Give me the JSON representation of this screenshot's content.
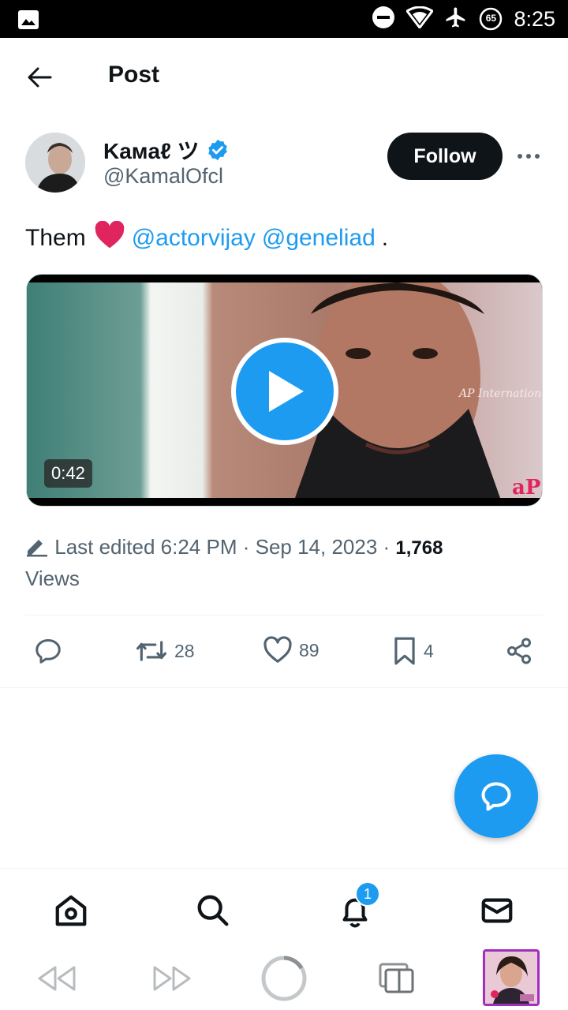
{
  "status_bar": {
    "time": "8:25",
    "battery_level": "65",
    "icons": [
      "image-icon",
      "do-not-disturb-icon",
      "wifi-icon",
      "airplane-icon",
      "battery-icon"
    ]
  },
  "header": {
    "title": "Post",
    "back_icon": "arrow-left-icon"
  },
  "author": {
    "name": "Kaмaℓ ツ",
    "handle": "@KamalOfcl",
    "verified": true,
    "follow_label": "Follow",
    "more_icon": "more-horizontal-icon"
  },
  "tweet": {
    "text_prefix": "Them",
    "emoji": "heart-emoji",
    "mention_1": "@actorvijay",
    "mention_2": "@geneliad",
    "text_suffix": "."
  },
  "video": {
    "duration": "0:42",
    "play_icon": "play-icon"
  },
  "meta": {
    "edited_icon": "pencil-icon",
    "edited_text": "Last edited 6:24 PM · Sep 14, 2023 ·",
    "views_count": "1,768",
    "views_label": "Views"
  },
  "actions": {
    "reply_count": "",
    "retweet_count": "28",
    "like_count": "89",
    "bookmark_count": "4"
  },
  "bottom_nav": {
    "notifications_badge": "1",
    "items": [
      "home-icon",
      "search-icon",
      "bell-icon",
      "mail-icon"
    ]
  },
  "browser_bar": {
    "items": [
      "rewind-icon",
      "fast-forward-icon",
      "loading-icon",
      "tabs-icon",
      "thumbnail"
    ]
  },
  "colors": {
    "accent": "#1d9bf0",
    "text": "#0f1419",
    "muted": "#536471",
    "heart": "#e0245e"
  }
}
